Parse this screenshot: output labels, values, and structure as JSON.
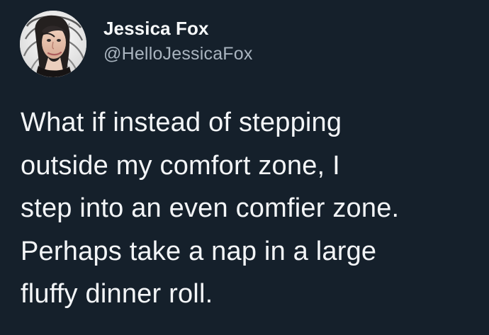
{
  "tweet": {
    "author": {
      "display_name": "Jessica Fox",
      "handle": "@HelloJessicaFox",
      "avatar_icon": "profile-photo"
    },
    "text_lines": [
      "What if instead of stepping",
      "outside my comfort zone, I",
      "step into an even comfier zone.",
      "Perhaps take a nap in a large",
      "fluffy dinner roll."
    ]
  },
  "colors": {
    "background": "#15202b",
    "primary_text": "#f3f5f7",
    "secondary_text": "#a9b4bf"
  }
}
